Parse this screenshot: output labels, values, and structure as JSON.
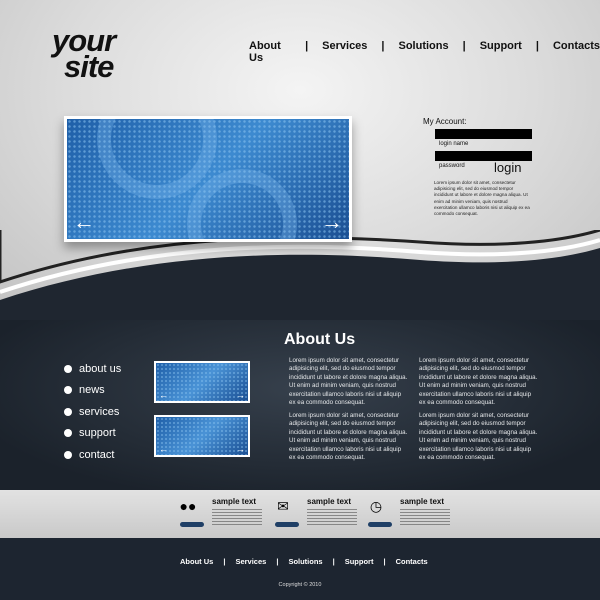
{
  "logo": {
    "line1": "your",
    "line2": "site"
  },
  "nav": [
    "About Us",
    "Services",
    "Solutions",
    "Support",
    "Contacts"
  ],
  "account": {
    "title": "My Account:",
    "login_name_label": "login name",
    "password_label": "password",
    "login_button": "login",
    "text": "Lorem ipsum dolor sit amet, consectetur adipisicing elit, sed do eiusmod tempor incididunt ut labore et dolore magna aliqua. Ut enim ad minim veniam, quis nostrud exercitation ullamco laboris nisi ut aliquip ex ea commodo consequat."
  },
  "slider": {
    "prev_icon": "arrow-left-icon",
    "next_icon": "arrow-right-icon"
  },
  "sidebar": [
    "about us",
    "news",
    "services",
    "support",
    "contact"
  ],
  "about": {
    "title": "About Us",
    "paragraph": "Lorem ipsum dolor sit amet, consectetur adipisicing elit, sed do eiusmod tempor incididunt ut labore et dolore magna aliqua. Ut enim ad minim veniam, quis nostrud exercitation ullamco laboris nisi ut aliquip ex ea commodo consequat."
  },
  "features": [
    {
      "icon": "speech-bubbles-icon",
      "title": "sample text"
    },
    {
      "icon": "envelope-icon",
      "title": "sample text"
    },
    {
      "icon": "clock-icon",
      "title": "sample text"
    }
  ],
  "footer": {
    "nav": [
      "About Us",
      "Services",
      "Solutions",
      "Support",
      "Contacts"
    ],
    "copyright": "Copyright © 2010"
  }
}
